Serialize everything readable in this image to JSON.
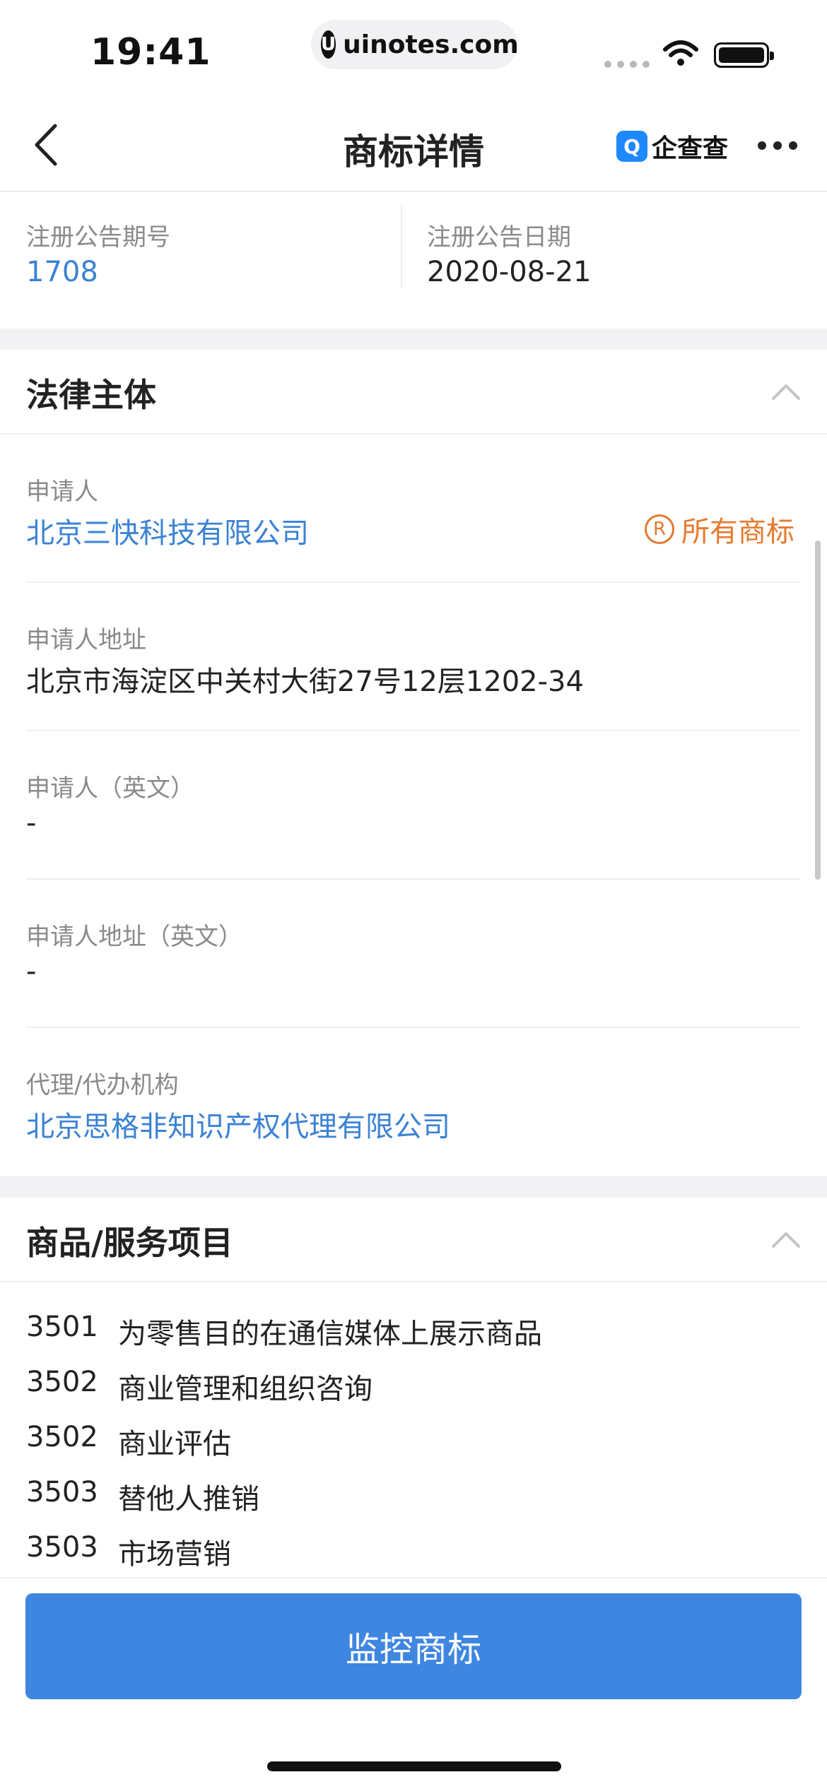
{
  "status_bar": {
    "time": "19:41",
    "url": "uinotes.com",
    "url_icon": "U"
  },
  "nav": {
    "title": "商标详情",
    "brand_name": "企查查",
    "brand_logo_glyph": "Q",
    "back_icon": "chevron-left-icon",
    "more_icon": "more-icon"
  },
  "announcement": {
    "issue_label": "注册公告期号",
    "issue_value": "1708",
    "date_label": "注册公告日期",
    "date_value": "2020-08-21"
  },
  "legal": {
    "title": "法律主体",
    "applicant_label": "申请人",
    "applicant_value": "北京三快科技有限公司",
    "all_trademarks_label": "所有商标",
    "all_trademarks_icon_glyph": "R",
    "address_label": "申请人地址",
    "address_value": "北京市海淀区中关村大街27号12层1202-34",
    "applicant_en_label": "申请人（英文）",
    "applicant_en_value": "-",
    "address_en_label": "申请人地址（英文）",
    "address_en_value": "-",
    "agency_label": "代理/代办机构",
    "agency_value": "北京思格非知识产权代理有限公司"
  },
  "goods": {
    "title": "商品/服务项目",
    "items": [
      {
        "code": "3501",
        "name": "为零售目的在通信媒体上展示商品"
      },
      {
        "code": "3502",
        "name": "商业管理和组织咨询"
      },
      {
        "code": "3502",
        "name": "商业评估"
      },
      {
        "code": "3503",
        "name": "替他人推销"
      },
      {
        "code": "3503",
        "name": "市场营销"
      }
    ]
  },
  "actions": {
    "monitor_label": "监控商标"
  },
  "colors": {
    "accent": "#3e86e0",
    "link": "#3b82d4",
    "orange": "#e67a2e",
    "band": "#f2f2f4"
  }
}
